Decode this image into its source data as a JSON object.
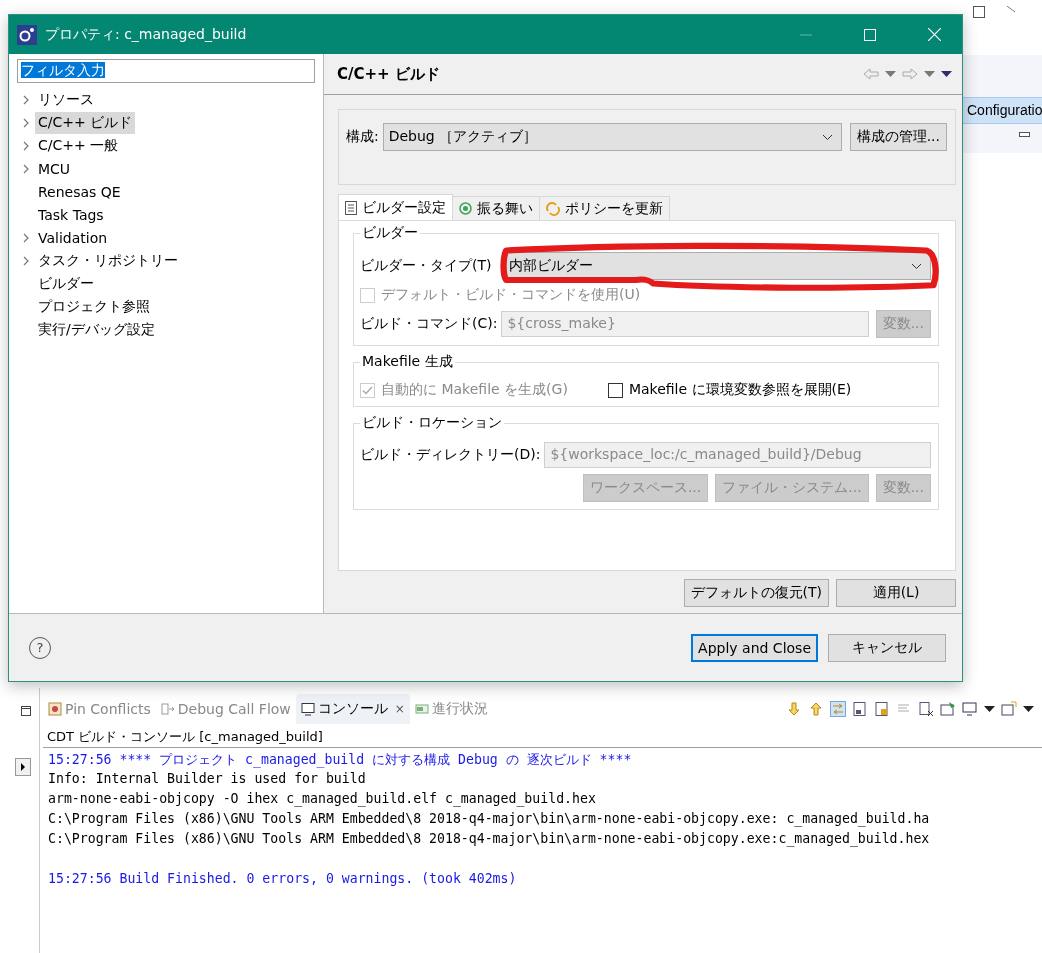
{
  "background": {
    "header_tab": "Configuratio"
  },
  "dialog": {
    "title": "プロパティ: c_managed_build",
    "filter": {
      "value": "フィルタ入力"
    },
    "tree": [
      {
        "label": "リソース",
        "expandable": true,
        "selected": false
      },
      {
        "label": "C/C++ ビルド",
        "expandable": true,
        "selected": true
      },
      {
        "label": "C/C++ 一般",
        "expandable": true,
        "selected": false
      },
      {
        "label": "MCU",
        "expandable": true,
        "selected": false
      },
      {
        "label": "Renesas QE",
        "expandable": false,
        "selected": false
      },
      {
        "label": "Task Tags",
        "expandable": false,
        "selected": false
      },
      {
        "label": "Validation",
        "expandable": true,
        "selected": false
      },
      {
        "label": "タスク・リポジトリー",
        "expandable": true,
        "selected": false
      },
      {
        "label": "ビルダー",
        "expandable": false,
        "selected": false
      },
      {
        "label": "プロジェクト参照",
        "expandable": false,
        "selected": false
      },
      {
        "label": "実行/デバッグ設定",
        "expandable": false,
        "selected": false
      }
    ],
    "page_title": "C/C++ ビルド",
    "configuration": {
      "label": "構成:",
      "value": "Debug ［アクティブ］",
      "manage_button": "構成の管理..."
    },
    "tabs": [
      {
        "label": "ビルダー設定",
        "selected": true,
        "kind": "list"
      },
      {
        "label": "振る舞い",
        "selected": false,
        "kind": "radio"
      },
      {
        "label": "ポリシーを更新",
        "selected": false,
        "kind": "refresh"
      }
    ],
    "builder": {
      "title": "ビルダー",
      "type_label": "ビルダー・タイプ(T)",
      "type_value": "内部ビルダー",
      "default_command": {
        "label": "デフォルト・ビルド・コマンドを使用(U)",
        "checked": false,
        "disabled": true
      },
      "command_label": "ビルド・コマンド(C):",
      "command_value": "${cross_make}",
      "command_disabled": true,
      "variables_button": {
        "label": "変数...",
        "disabled": true
      }
    },
    "makefile": {
      "title": "Makefile 生成",
      "options": [
        {
          "label": "自動的に Makefile を生成(G)",
          "checked": true,
          "disabled": true
        },
        {
          "label": "Makefile に環境変数参照を展開(E)",
          "checked": false,
          "disabled": false
        }
      ]
    },
    "location": {
      "title": "ビルド・ロケーション",
      "directory_label": "ビルド・ディレクトリー(D):",
      "directory_value": "${workspace_loc:/c_managed_build}/Debug",
      "directory_disabled": true,
      "buttons": [
        {
          "label": "ワークスペース...",
          "disabled": true
        },
        {
          "label": "ファイル・システム...",
          "disabled": true
        },
        {
          "label": "変数...",
          "disabled": true
        }
      ]
    },
    "page_buttons": [
      "デフォルトの復元(T)",
      "適用(L)"
    ],
    "help_button": "?",
    "footer_buttons": [
      {
        "label": "Apply and Close",
        "default": true
      },
      {
        "label": "キャンセル",
        "default": false
      }
    ]
  },
  "console": {
    "tabs": [
      {
        "label": "Pin Conflicts",
        "selected": false,
        "closable": false
      },
      {
        "label": "Debug Call Flow",
        "selected": false,
        "closable": false
      },
      {
        "label": "コンソール",
        "selected": true,
        "closable": true
      },
      {
        "label": "進行状況",
        "selected": false,
        "closable": false
      }
    ],
    "close_mark": "×",
    "title": "CDT ビルド・コンソール [c_managed_build]",
    "lines": [
      {
        "text": "15:27:56 **** プロジェクト c_managed_build に対する構成 Debug の 逐次ビルド ****",
        "kind": "status",
        "gap_before": false
      },
      {
        "text": "Info: Internal Builder is used for build",
        "kind": "output",
        "gap_before": false
      },
      {
        "text": "arm-none-eabi-objcopy -O ihex c_managed_build.elf c_managed_build.hex",
        "kind": "output",
        "gap_before": false
      },
      {
        "text": "C:\\Program Files (x86)\\GNU Tools ARM Embedded\\8 2018-q4-major\\bin\\arm-none-eabi-objcopy.exe: c_managed_build.ha",
        "kind": "output",
        "gap_before": false
      },
      {
        "text": "C:\\Program Files (x86)\\GNU Tools ARM Embedded\\8 2018-q4-major\\bin\\arm-none-eabi-objcopy.exe:c_managed_build.hex",
        "kind": "output",
        "gap_before": false
      },
      {
        "text": "15:27:56 Build Finished. 0 errors, 0 warnings. (took 402ms)",
        "kind": "status",
        "gap_before": true
      }
    ]
  }
}
